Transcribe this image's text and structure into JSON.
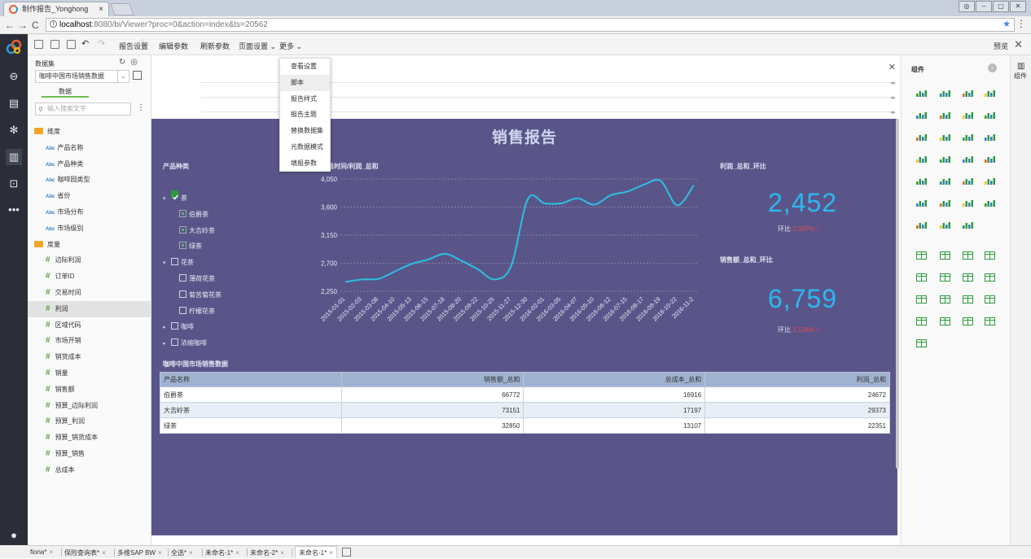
{
  "browser": {
    "tab_title": "制作报告_Yonghong",
    "url_host": "localhost",
    "url_rest": ":8080/bi/Viewer?proc=0&action=index&ts=20562"
  },
  "toolbar": {
    "items": [
      "报告设置",
      "编辑参数",
      "刷新参数",
      "页面设置 ⌄",
      "更多 ⌄"
    ],
    "preview": "预览"
  },
  "datapanel": {
    "title": "数据集",
    "dataset": "咖啡中国市场销售数据",
    "tab": "数据",
    "search_placeholder": "输入搜索文字",
    "dim_folder": "维度",
    "dimensions": [
      "产品名称",
      "产品种类",
      "咖啡园类型",
      "省份",
      "市场分布",
      "市场级别"
    ],
    "mea_folder": "度量",
    "measures": [
      "边际利润",
      "订单ID",
      "交易时间",
      "利润",
      "区域代码",
      "市场开销",
      "销货成本",
      "销量",
      "销售额",
      "预算_边际利润",
      "预算_利润",
      "预算_销货成本",
      "预算_销售",
      "总成本"
    ],
    "abc": "Abc"
  },
  "dropdown": [
    "查看设置",
    "脚本",
    "报告样式",
    "报告主题",
    "替换数据集",
    "元数据模式",
    "填报参数"
  ],
  "report": {
    "title": "销售报告",
    "filter_title": "产品种类",
    "tree": [
      {
        "label": "茶",
        "level": 0,
        "state": "checked",
        "arrow": "▾"
      },
      {
        "label": "伯爵茶",
        "level": 1,
        "state": "partial"
      },
      {
        "label": "大吉岭茶",
        "level": 1,
        "state": "partial"
      },
      {
        "label": "绿茶",
        "level": 1,
        "state": "partial"
      },
      {
        "label": "花茶",
        "level": 0,
        "state": "off",
        "arrow": "▾"
      },
      {
        "label": "薄荷花茶",
        "level": 1,
        "state": "off"
      },
      {
        "label": "菊苦菊花茶",
        "level": 1,
        "state": "off"
      },
      {
        "label": "柠檬花茶",
        "level": 1,
        "state": "off"
      },
      {
        "label": "咖啡",
        "level": 0,
        "state": "off",
        "arrow": "▸"
      },
      {
        "label": "浓缩咖啡",
        "level": 0,
        "state": "off",
        "arrow": "▸"
      }
    ],
    "chart_title": "交易时间/利润_总和",
    "kpi1": {
      "title": "利润_总和_环比",
      "value": "2,452",
      "label": "环比",
      "change": "2.167% ↑"
    },
    "kpi2": {
      "title": "销售额_总和_环比",
      "value": "6,759",
      "label": "环比",
      "change": "1.524% ↑"
    },
    "table_title": "咖啡中国市场销售数据",
    "table": {
      "columns": [
        "产品名称",
        "销售额_总和",
        "总成本_总和",
        "利润_总和"
      ],
      "rows": [
        [
          "伯爵茶",
          "66772",
          "16916",
          "24672"
        ],
        [
          "大吉岭茶",
          "73151",
          "17197",
          "29373"
        ],
        [
          "绿茶",
          "32850",
          "13107",
          "22351"
        ]
      ]
    }
  },
  "chart_data": {
    "type": "line",
    "title": "交易时间/利润_总和",
    "x": [
      "2015-01-01",
      "2015-02-03",
      "2015-03-08",
      "2015-04-10",
      "2015-05-13",
      "2015-06-15",
      "2015-07-18",
      "2015-08-20",
      "2015-09-22",
      "2015-10-25",
      "2015-11-27",
      "2015-12-30",
      "2016-02-01",
      "2016-03-05",
      "2016-04-07",
      "2016-05-10",
      "2016-06-12",
      "2016-07-15",
      "2016-08-17",
      "2016-09-19",
      "2016-10-22",
      "2016-11-2"
    ],
    "series": [
      {
        "values": [
          2400,
          2440,
          2450,
          2570,
          2690,
          2760,
          2850,
          2740,
          2600,
          2440,
          2660,
          3730,
          3660,
          3660,
          3740,
          3640,
          3790,
          3850,
          3960,
          4020,
          3630,
          3950
        ]
      }
    ],
    "y_ticks": [
      "4,050",
      "3,600",
      "3,150",
      "2,700",
      "2,250"
    ],
    "ylim": [
      2250,
      4050
    ],
    "color": "#2bc0e0",
    "grid": true
  },
  "rightpanel": {
    "title": "组件",
    "rail_label": "组件"
  },
  "bottom_tabs": [
    "fiona*",
    "保险查询表*",
    "多维SAP BW",
    "全选*",
    "未命名-1*",
    "未命名-2*",
    "未命名-1*"
  ]
}
